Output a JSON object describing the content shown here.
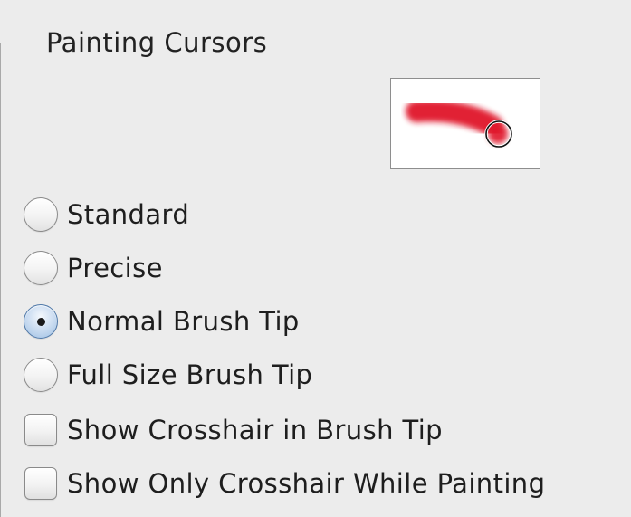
{
  "group": {
    "title": "Painting Cursors"
  },
  "preview": {
    "stroke_color": "#e0192a",
    "description_icon": "brush-stroke-preview-icon"
  },
  "options": {
    "standard_label": "Standard",
    "precise_label": "Precise",
    "normal_brush_tip_label": "Normal Brush Tip",
    "full_size_brush_tip_label": "Full Size Brush Tip",
    "show_crosshair_label": "Show Crosshair in Brush Tip",
    "show_only_crosshair_label": "Show Only Crosshair While Painting",
    "selected": "Normal Brush Tip",
    "show_crosshair_checked": false,
    "show_only_crosshair_checked": false
  },
  "colors": {
    "background": "#ececec",
    "radio_selected": "#9dbfe3",
    "border": "#a9a9a9"
  }
}
